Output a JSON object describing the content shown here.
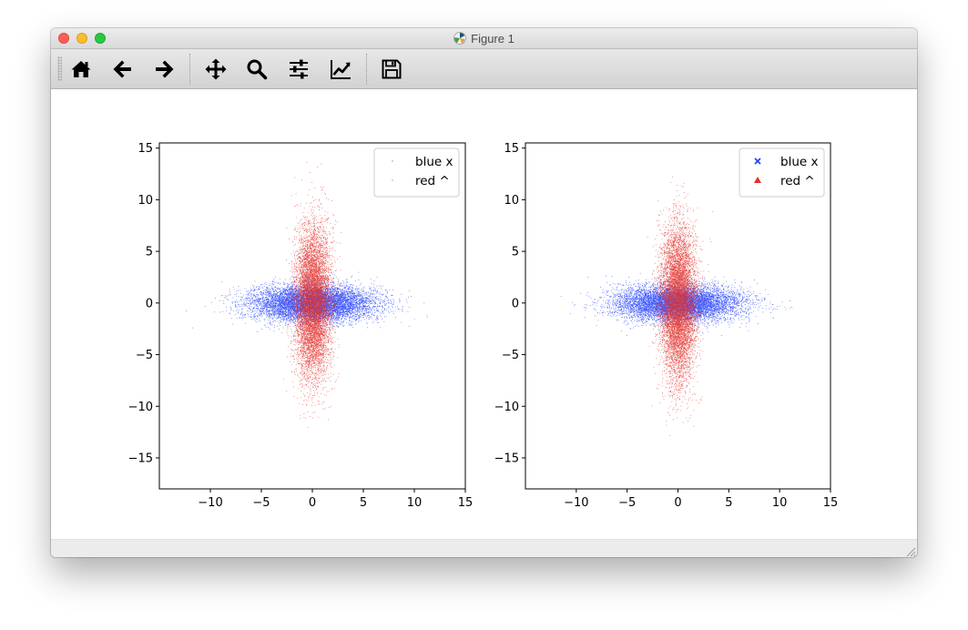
{
  "window": {
    "title": "Figure 1",
    "app_icon": "matplotlib-icon",
    "controls": [
      "close",
      "minimize",
      "zoom"
    ]
  },
  "toolbar": {
    "items": [
      {
        "name": "home",
        "icon": "home-icon"
      },
      {
        "name": "back",
        "icon": "arrow-left-icon"
      },
      {
        "name": "forward",
        "icon": "arrow-right-icon"
      },
      {
        "name": "pan",
        "icon": "move-icon"
      },
      {
        "name": "zoom",
        "icon": "zoom-icon"
      },
      {
        "name": "subplots",
        "icon": "sliders-icon"
      },
      {
        "name": "edit-axis",
        "icon": "line-chart-icon"
      },
      {
        "name": "save",
        "icon": "floppy-disk-icon"
      }
    ]
  },
  "colors": {
    "blue": "#1e3dff",
    "red": "#e3302a",
    "axis": "#000000",
    "legend_border": "#cccccc"
  },
  "chart_data": [
    {
      "type": "scatter",
      "xlim": [
        -15,
        15
      ],
      "ylim": [
        -18,
        15.5
      ],
      "xticks": [
        -10,
        -5,
        0,
        5,
        10,
        15
      ],
      "yticks": [
        15,
        10,
        5,
        0,
        -5,
        -10,
        -15
      ],
      "grid": false,
      "legend_position": "top-right",
      "series": [
        {
          "name": "blue x",
          "marker": "pixel",
          "color": "#1e3dff",
          "distribution": {
            "x_std": 3.0,
            "y_std": 0.85,
            "count": 9000
          }
        },
        {
          "name": "red ^",
          "marker": "pixel",
          "color": "#e3302a",
          "distribution": {
            "x_std": 0.85,
            "y_std": 3.5,
            "count": 9000
          }
        }
      ]
    },
    {
      "type": "scatter",
      "xlim": [
        -15,
        15
      ],
      "ylim": [
        -18,
        15.5
      ],
      "xticks": [
        -10,
        -5,
        0,
        5,
        10,
        15
      ],
      "yticks": [
        15,
        10,
        5,
        0,
        -5,
        -10,
        -15
      ],
      "grid": false,
      "legend_position": "top-right",
      "series": [
        {
          "name": "blue x",
          "marker": "x",
          "color": "#1e3dff",
          "distribution": {
            "x_std": 3.0,
            "y_std": 0.85,
            "count": 9000
          }
        },
        {
          "name": "red ^",
          "marker": "^",
          "color": "#e3302a",
          "distribution": {
            "x_std": 0.85,
            "y_std": 3.5,
            "count": 9000
          }
        }
      ]
    }
  ]
}
